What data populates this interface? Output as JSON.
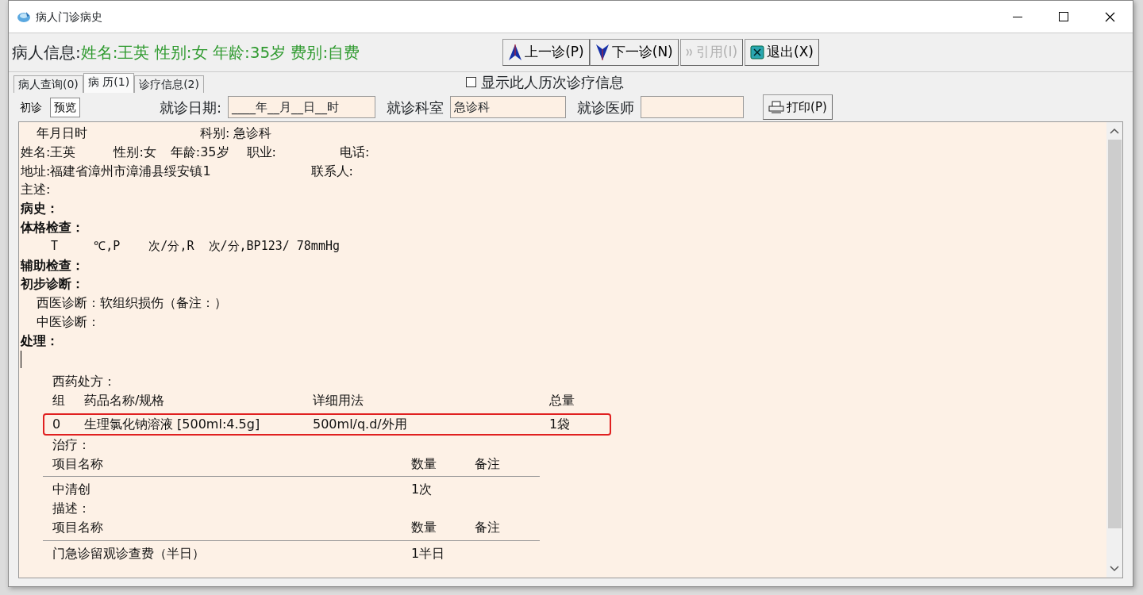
{
  "window": {
    "title": "病人门诊病史"
  },
  "patient_info": {
    "label": "病人信息:",
    "value": "姓名:王英 性别:女 年龄:35岁 费别:自费"
  },
  "toolbar": [
    {
      "label": "上一诊(P)",
      "disabled": false
    },
    {
      "label": "下一诊(N)",
      "disabled": false
    },
    {
      "label": "引用(I)",
      "disabled": true
    },
    {
      "label": "退出(X)",
      "disabled": false
    }
  ],
  "tabs": [
    {
      "label": "病人查询(0)",
      "selected": false
    },
    {
      "label": "病 历(1)",
      "selected": true
    },
    {
      "label": "诊疗信息(2)",
      "selected": false
    }
  ],
  "history_checkbox": {
    "label": "显示此人历次诊疗信息",
    "checked": false
  },
  "subtabs": [
    {
      "label": "初诊",
      "selected": false
    },
    {
      "label": "预览",
      "selected": true
    }
  ],
  "fields": [
    {
      "label": "就诊日期:",
      "value": "____年__月__日__时"
    },
    {
      "label": "就诊科室",
      "value": "急诊科"
    },
    {
      "label": "就诊医师"
    }
  ],
  "print_button": "打印(P)",
  "record": [
    {
      "kind": "header",
      "parts": [
        "年月日时",
        "科别: 急诊科"
      ]
    },
    {
      "kind": "info",
      "parts": [
        "姓名:王英",
        "性别:女",
        "年龄:35岁",
        "职业:",
        "电话:"
      ]
    },
    {
      "kind": "address",
      "parts": [
        "地址:福建省漳州市漳浦县绥安镇1",
        "联系人:"
      ]
    },
    {
      "kind": "plain",
      "text": "主述:"
    },
    {
      "kind": "heading",
      "text": "病史："
    },
    {
      "kind": "heading",
      "text": "体格检查："
    },
    {
      "kind": "vitals",
      "text": "T     ℃,P    次/分,R  次/分,BP123/ 78mmHg"
    },
    {
      "kind": "heading",
      "text": "辅助检查："
    },
    {
      "kind": "heading",
      "text": "初步诊断："
    },
    {
      "kind": "sub",
      "text": "西医诊断：软组织损伤（备注：）"
    },
    {
      "kind": "sub",
      "text": "中医诊断："
    },
    {
      "kind": "heading",
      "text": "处理："
    },
    {
      "kind": "cursor"
    }
  ],
  "prescription": {
    "title": "西药处方：",
    "columns": [
      "组",
      "药品名称/规格",
      "详细用法",
      "总量"
    ],
    "rows": [
      {
        "cells": [
          "0",
          "生理氯化钠溶液 [500ml:4.5g]",
          "500ml/q.d/外用",
          "1袋"
        ],
        "highlighted": true
      }
    ]
  },
  "sections": [
    {
      "title": "治疗：",
      "columns": [
        "项目名称",
        "数量",
        "备注"
      ],
      "rows": [
        [
          "中清创",
          "1次"
        ]
      ]
    },
    {
      "title": "描述：",
      "columns": [
        "项目名称",
        "数量",
        "备注"
      ],
      "rows": [
        [
          "门急诊留观诊查费（半日）",
          "1半日"
        ]
      ]
    }
  ]
}
